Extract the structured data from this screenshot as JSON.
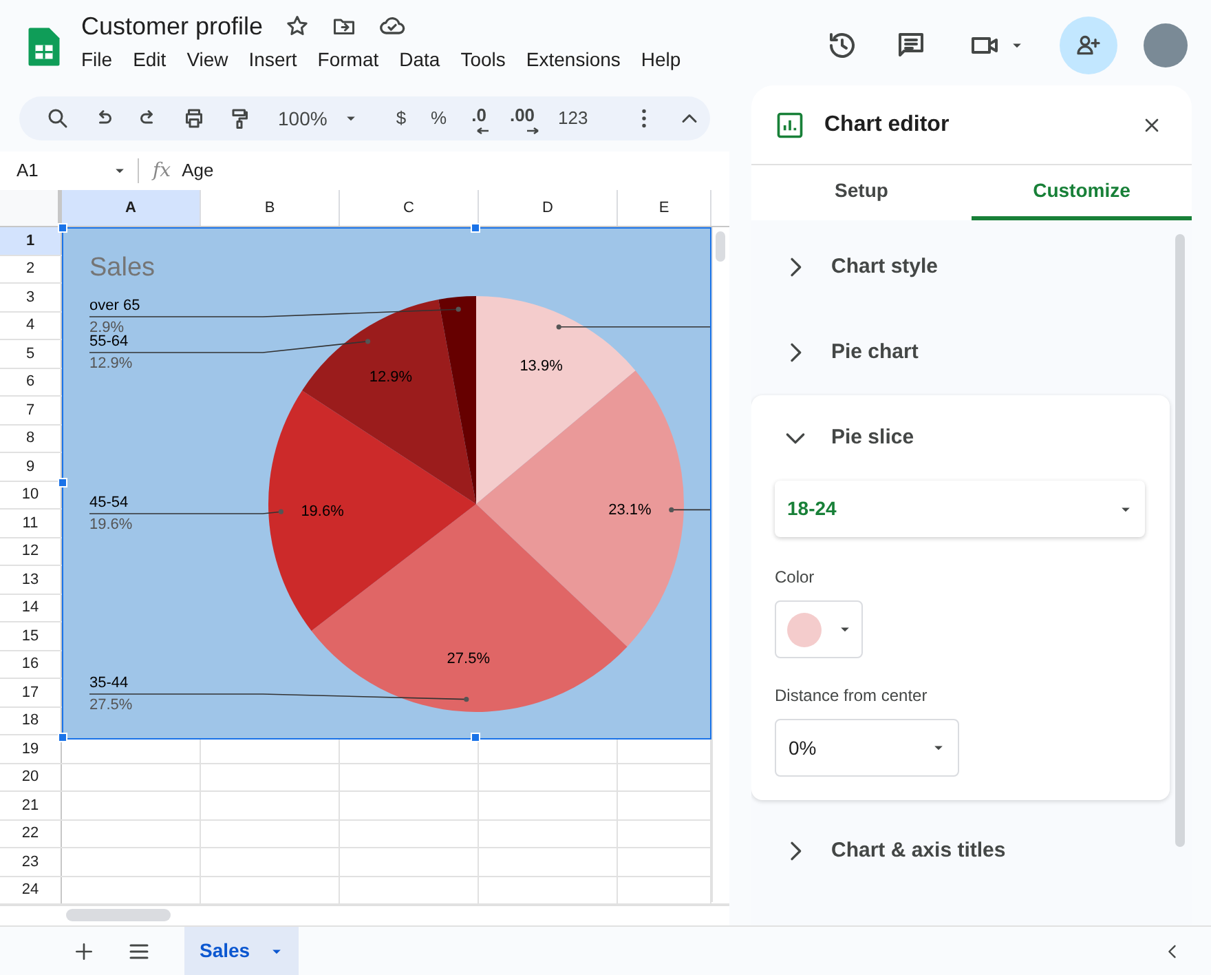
{
  "document": {
    "title": "Customer profile"
  },
  "menu": [
    "File",
    "Edit",
    "View",
    "Insert",
    "Format",
    "Data",
    "Tools",
    "Extensions",
    "Help"
  ],
  "toolbar": [
    {
      "kind": "icon"
    },
    {
      "kind": "icon"
    },
    {
      "kind": "icon"
    },
    {
      "kind": "icon"
    },
    {
      "kind": "icon"
    },
    {
      "kind": "select",
      "text": "100%"
    },
    {
      "kind": "divider"
    },
    {
      "kind": "text",
      "text": "$"
    },
    {
      "kind": "text",
      "text": "%"
    },
    {
      "kind": "decimal-down",
      "text": ".0"
    },
    {
      "kind": "decimal-up",
      "text": ".00"
    },
    {
      "kind": "text",
      "text": "123"
    },
    {
      "kind": "divider"
    },
    {
      "kind": "icon"
    },
    {
      "kind": "icon"
    }
  ],
  "formula_bar": {
    "cell_reference": "A1",
    "function_label": "fx",
    "value": "Age"
  },
  "grid": {
    "columns": [
      {
        "label": "A",
        "selected": true
      },
      {
        "label": "B",
        "selected": false
      },
      {
        "label": "C",
        "selected": false
      },
      {
        "label": "D",
        "selected": false
      },
      {
        "label": "E",
        "selected": false
      }
    ],
    "rows": [
      {
        "label": "1",
        "selected": true
      },
      {
        "label": "2",
        "selected": false
      },
      {
        "label": "3",
        "selected": false
      },
      {
        "label": "4",
        "selected": false
      },
      {
        "label": "5",
        "selected": false
      },
      {
        "label": "6",
        "selected": false
      },
      {
        "label": "7",
        "selected": false
      },
      {
        "label": "8",
        "selected": false
      },
      {
        "label": "9",
        "selected": false
      },
      {
        "label": "10",
        "selected": false
      },
      {
        "label": "11",
        "selected": false
      },
      {
        "label": "12",
        "selected": false
      },
      {
        "label": "13",
        "selected": false
      },
      {
        "label": "14",
        "selected": false
      },
      {
        "label": "15",
        "selected": false
      },
      {
        "label": "16",
        "selected": false
      },
      {
        "label": "17",
        "selected": false
      },
      {
        "label": "18",
        "selected": false
      },
      {
        "label": "19",
        "selected": false
      },
      {
        "label": "20",
        "selected": false
      },
      {
        "label": "21",
        "selected": false
      },
      {
        "label": "22",
        "selected": false
      },
      {
        "label": "23",
        "selected": false
      },
      {
        "label": "24",
        "selected": false
      }
    ]
  },
  "chart": {
    "chart_data": {
      "type": "pie",
      "title": "Sales",
      "values": [
        13.9,
        23.1,
        27.5,
        19.6,
        12.9,
        2.9
      ],
      "colors": [
        "#f4cccc",
        "#ea9999",
        "#e06666",
        "#cc2a2a",
        "#9b1c1c",
        "#660000"
      ],
      "value_labels": [
        "13.9%",
        "23.1%",
        "27.5%",
        "19.6%",
        "12.9%",
        null
      ],
      "annotations": [
        {
          "text": "over 65"
        },
        {
          "text": "2.9%"
        },
        {
          "text": "55-64"
        },
        {
          "text": "12.9%"
        },
        {
          "text": "45-54"
        },
        {
          "text": "19.6%"
        },
        {
          "text": "35-44"
        },
        {
          "text": "27.5%"
        }
      ]
    }
  },
  "sheet_tabs": [
    {
      "label": "Sales",
      "selected": true
    }
  ],
  "chart_editor": {
    "title": "Chart editor",
    "tabs": [
      {
        "label": "Setup",
        "selected": false
      },
      {
        "label": "Customize",
        "selected": true
      }
    ],
    "sections": [
      {
        "title": "Chart style",
        "expanded": false
      },
      {
        "title": "Pie chart",
        "expanded": false
      },
      {
        "title": "Pie slice",
        "expanded": true
      },
      {
        "title": "Chart & axis titles",
        "expanded": false
      }
    ],
    "pie_slice": {
      "slice": "18-24",
      "color_label": "Color",
      "color": "#f4cccc",
      "distance_label": "Distance from center",
      "distance": "0%"
    }
  }
}
